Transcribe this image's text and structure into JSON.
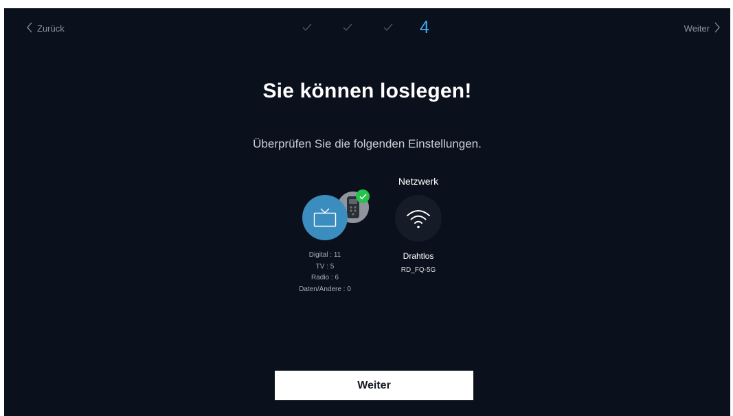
{
  "nav": {
    "back_label": "Zurück",
    "next_label": "Weiter"
  },
  "steps": {
    "completed_count": 3,
    "current": "4"
  },
  "headline": "Sie können loslegen!",
  "subtitle": "Überprüfen Sie die folgenden Einstellungen.",
  "channels": {
    "icon": "tv-icon",
    "secondary_icon": "antenna-icon",
    "status_icon": "check-icon",
    "stats": [
      "Digital : 11",
      "TV : 5",
      "Radio : 6",
      "Daten/Andere : 0"
    ]
  },
  "network": {
    "title": "Netzwerk",
    "icon": "wifi-icon",
    "type": "Drahtlos",
    "ssid": "RD_FQ-5G"
  },
  "continue_button": "Weiter",
  "colors": {
    "background": "#0b111c",
    "accent": "#3fa9f5",
    "tv_circle": "#3b8dc0",
    "success": "#27c24c",
    "button_bg": "#ffffff"
  }
}
